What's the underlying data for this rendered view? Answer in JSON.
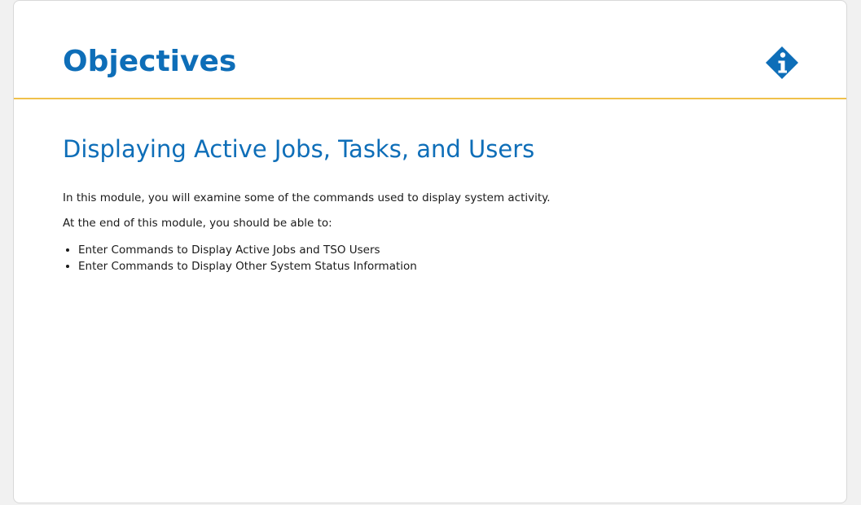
{
  "header": {
    "title": "Objectives",
    "icon": "info-icon",
    "accent_color": "#0e6eb8",
    "divider_color": "#f0c14b"
  },
  "content": {
    "section_title": "Displaying Active Jobs, Tasks, and Users",
    "intro": "In this module, you will examine some of the commands used to display system activity.",
    "lead": "At the end of this module, you should be able to:",
    "objectives": [
      "Enter Commands to Display Active Jobs and TSO Users",
      "Enter Commands to Display Other System Status Information"
    ]
  }
}
